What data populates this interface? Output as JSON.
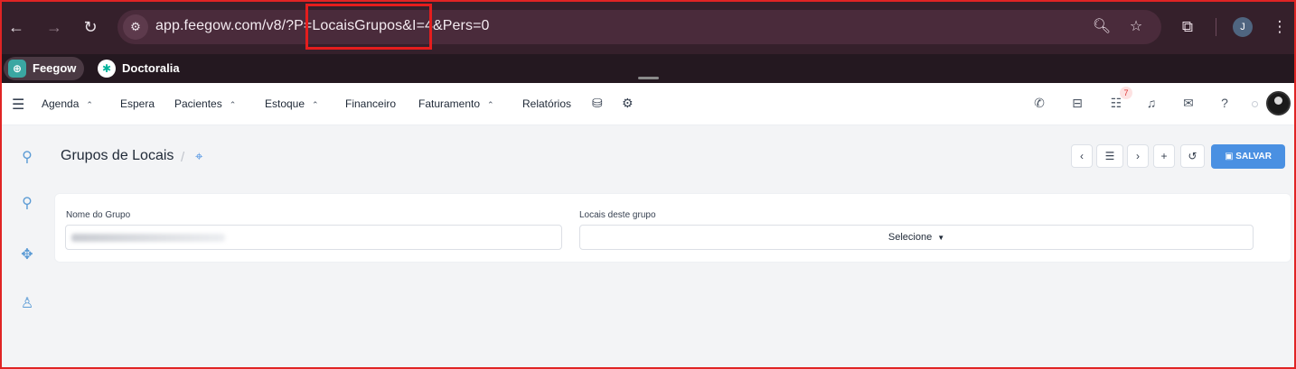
{
  "browser": {
    "url_prefix": "app.feegow.com/v8/?P=",
    "url_highlight": "LocaisGrupos&I=4",
    "url_suffix": "&Pers=0",
    "profile_initial": "J",
    "bookmarks": [
      {
        "label": "Feegow"
      },
      {
        "label": "Doctoralia"
      }
    ]
  },
  "nav": {
    "items": [
      {
        "label": "Agenda"
      },
      {
        "label": "Espera"
      },
      {
        "label": "Pacientes"
      },
      {
        "label": "Estoque"
      },
      {
        "label": "Financeiro"
      },
      {
        "label": "Faturamento"
      },
      {
        "label": "Relatórios"
      }
    ],
    "notification_count": "7"
  },
  "header": {
    "title": "Grupos de Locais",
    "save_label": "SALVAR"
  },
  "form": {
    "name_label": "Nome do Grupo",
    "locations_label": "Locais deste grupo",
    "select_placeholder": "Selecione"
  },
  "colors": {
    "accent": "#4a90e2",
    "chrome": "#35202b",
    "highlight": "#e51d1d"
  }
}
